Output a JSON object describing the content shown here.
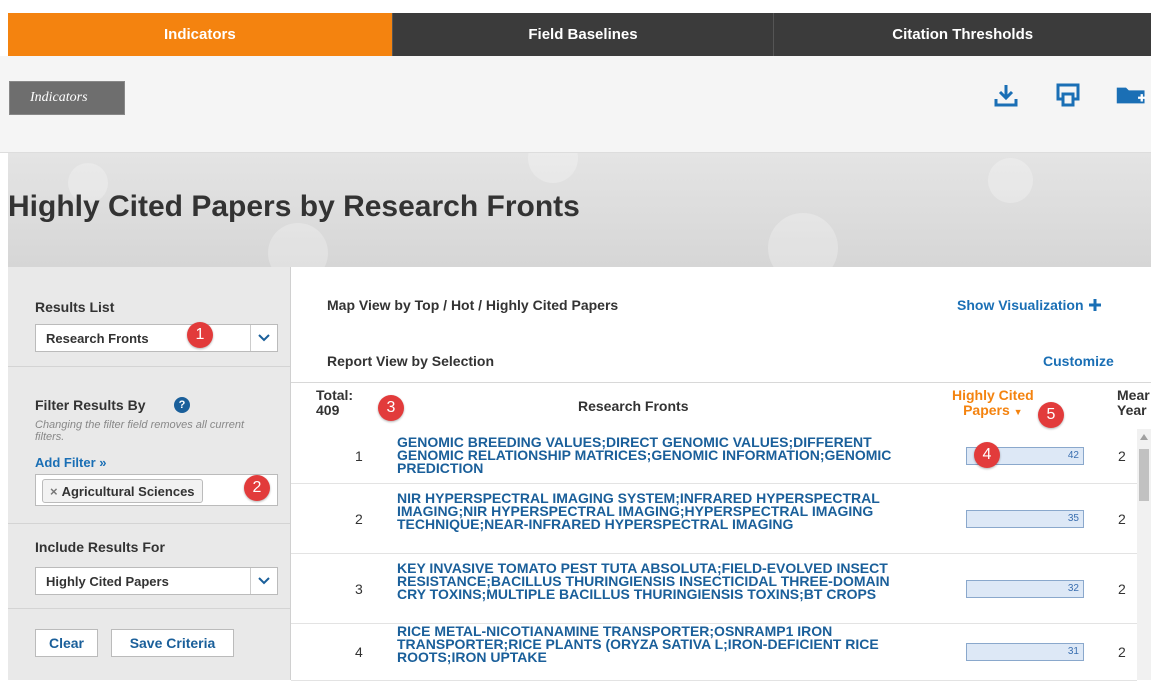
{
  "tabs": [
    {
      "label": "Indicators",
      "active": true
    },
    {
      "label": "Field Baselines",
      "active": false
    },
    {
      "label": "Citation Thresholds",
      "active": false
    }
  ],
  "toolbar": {
    "breadcrumb": "Indicators",
    "icons": [
      "download-icon",
      "print-icon",
      "add-folder-icon"
    ]
  },
  "page_title": "Highly Cited Papers by Research Fronts",
  "sidebar": {
    "results_list": {
      "title": "Results List",
      "value": "Research Fronts",
      "badge": "1"
    },
    "filter": {
      "title": "Filter Results By",
      "help": "?",
      "note": "Changing the filter field removes all current filters.",
      "add_filter": "Add Filter »",
      "chip_x": "×",
      "chip_label": "Agricultural Sciences",
      "badge": "2"
    },
    "include": {
      "title": "Include Results For",
      "value": "Highly Cited Papers"
    },
    "buttons": {
      "clear": "Clear",
      "save": "Save Criteria"
    }
  },
  "main": {
    "map_view": "Map View by Top / Hot / Highly Cited Papers",
    "show_viz": "Show Visualization",
    "report_view": "Report View by Selection",
    "customize": "Customize",
    "table": {
      "total_label": "Total:",
      "total_value": "409",
      "badge3": "3",
      "col_fronts": "Research Fronts",
      "col_hcp_line1": "Highly Cited",
      "col_hcp_line2": "Papers",
      "badge4": "4",
      "badge5": "5",
      "col_mean_line1": "Mear",
      "col_mean_line2": "Year",
      "rows": [
        {
          "num": "1",
          "front": "GENOMIC BREEDING VALUES;DIRECT GENOMIC VALUES;DIFFERENT GENOMIC RELATIONSHIP MATRICES;GENOMIC INFORMATION;GENOMIC PREDICTION",
          "hcp": "42",
          "fill": 0.9,
          "mean": "2"
        },
        {
          "num": "2",
          "front": "NIR HYPERSPECTRAL IMAGING SYSTEM;INFRARED HYPERSPECTRAL IMAGING;NIR HYPERSPECTRAL IMAGING;HYPERSPECTRAL IMAGING TECHNIQUE;NEAR-INFRARED HYPERSPECTRAL IMAGING",
          "hcp": "35",
          "fill": 0.75,
          "mean": "2"
        },
        {
          "num": "3",
          "front": "KEY INVASIVE TOMATO PEST TUTA ABSOLUTA;FIELD-EVOLVED INSECT RESISTANCE;BACILLUS THURINGIENSIS INSECTICIDAL THREE-DOMAIN CRY TOXINS;MULTIPLE BACILLUS THURINGIENSIS TOXINS;BT CROPS",
          "hcp": "32",
          "fill": 0.68,
          "mean": "2"
        },
        {
          "num": "4",
          "front": "RICE METAL-NICOTIANAMINE TRANSPORTER;OSNRAMP1 IRON TRANSPORTER;RICE PLANTS (ORYZA SATIVA L;IRON-DEFICIENT RICE ROOTS;IRON UPTAKE",
          "hcp": "31",
          "fill": 0.66,
          "mean": "2"
        }
      ]
    }
  },
  "colors": {
    "accent": "#f4830f",
    "link": "#1a5f9a",
    "badge": "#e23b3b",
    "bar_fill": "#dde8f6"
  }
}
